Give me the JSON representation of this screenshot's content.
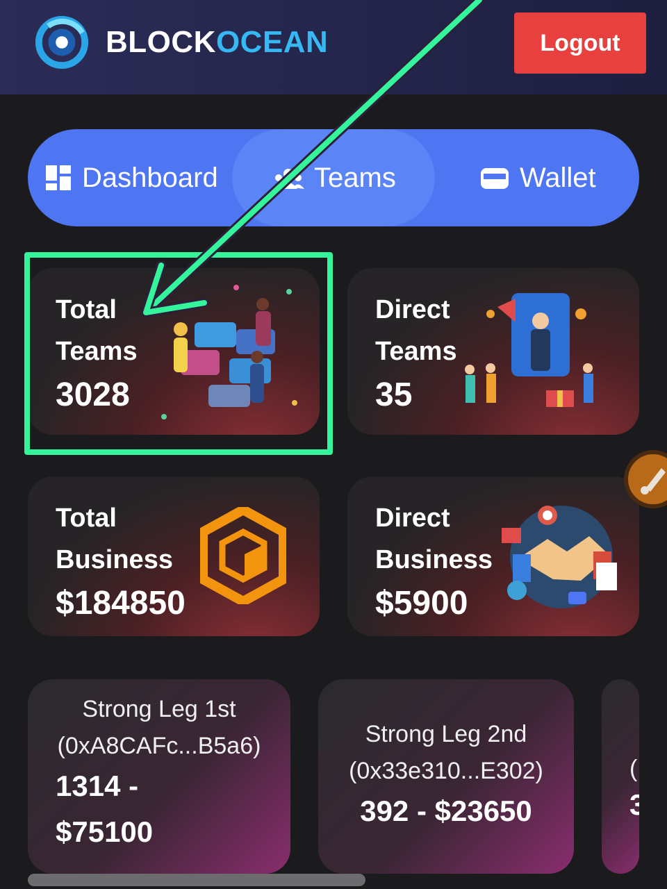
{
  "header": {
    "brand_part1": "BLOCK",
    "brand_part2": "OCEAN",
    "logout_label": "Logout"
  },
  "nav": {
    "items": [
      {
        "label": "Dashboard",
        "icon": "dashboard-grid-icon"
      },
      {
        "label": "Teams",
        "icon": "users-icon",
        "active": true
      },
      {
        "label": "Wallet",
        "icon": "wallet-icon"
      }
    ]
  },
  "stats": {
    "total_teams": {
      "line1": "Total",
      "line2": "Teams",
      "value": "3028"
    },
    "direct_teams": {
      "line1": "Direct",
      "line2": "Teams",
      "value": "35"
    },
    "total_business": {
      "line1": "Total",
      "line2": "Business",
      "value": "$184850"
    },
    "direct_business": {
      "line1": "Direct",
      "line2": "Business",
      "value": "$5900"
    }
  },
  "legs": [
    {
      "title": "Strong Leg 1st",
      "address": "(0xA8CAFc...B5a6)",
      "value_line1": "1314 -",
      "value_line2": "$75100"
    },
    {
      "title": "Strong Leg 2nd",
      "address": "(0x33e310...E302)",
      "value": "392 - $23650"
    },
    {
      "partial_line1": "(",
      "partial_line2": "3"
    }
  ],
  "colors": {
    "accent_nav": "#4e75f2",
    "logout": "#e8403f",
    "brand_blue": "#37b8f2",
    "highlight": "#35f59c"
  }
}
